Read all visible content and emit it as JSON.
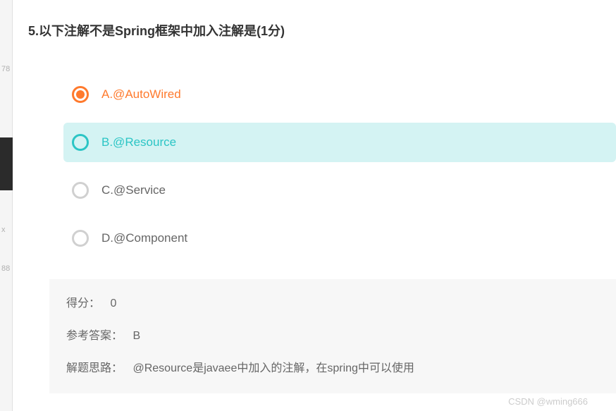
{
  "question": {
    "number": "5",
    "text": "5.以下注解不是Spring框架中加入注解是(1分)",
    "options": [
      {
        "key": "A",
        "label": "A.@AutoWired",
        "selected": true,
        "correct": false
      },
      {
        "key": "B",
        "label": "B.@Resource",
        "selected": false,
        "correct": true
      },
      {
        "key": "C",
        "label": "C.@Service",
        "selected": false,
        "correct": false
      },
      {
        "key": "D",
        "label": "D.@Component",
        "selected": false,
        "correct": false
      }
    ]
  },
  "answer": {
    "score_label": "得分：",
    "score_value": "0",
    "reference_label": "参考答案：",
    "reference_value": "B",
    "explanation_label": "解题思路：",
    "explanation_value": "@Resource是javaee中加入的注解，在spring中可以使用"
  },
  "gutter": {
    "m1": "78",
    "m2": "x",
    "m3": "88"
  },
  "watermark": "CSDN @wming666"
}
